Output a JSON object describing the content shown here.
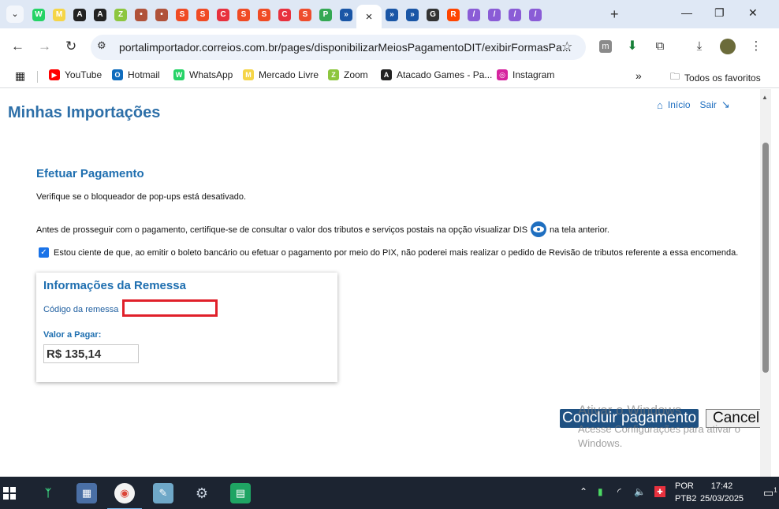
{
  "browser": {
    "tabs": [
      {
        "icon": "whatsapp-icon",
        "color": "#25d366",
        "glyph": "W"
      },
      {
        "icon": "mercadolivre-icon",
        "color": "#f5d547",
        "glyph": "M"
      },
      {
        "icon": "atacado-games-icon",
        "color": "#222222",
        "glyph": "A"
      },
      {
        "icon": "atacado-games-icon",
        "color": "#222222",
        "glyph": "A"
      },
      {
        "icon": "zoom-icon",
        "color": "#8dc63f",
        "glyph": "Z"
      },
      {
        "icon": "avatar-icon",
        "color": "#b0523a",
        "glyph": "•"
      },
      {
        "icon": "avatar-icon",
        "color": "#b0523a",
        "glyph": "•"
      },
      {
        "icon": "shop-icon",
        "color": "#f04b24",
        "glyph": "S"
      },
      {
        "icon": "shop-icon",
        "color": "#f04b24",
        "glyph": "S"
      },
      {
        "icon": "cart-icon",
        "color": "#e8313e",
        "glyph": "C"
      },
      {
        "icon": "shop-icon",
        "color": "#f04b24",
        "glyph": "S"
      },
      {
        "icon": "shop-icon",
        "color": "#f04b24",
        "glyph": "S"
      },
      {
        "icon": "cart-icon",
        "color": "#e8313e",
        "glyph": "C"
      },
      {
        "icon": "shopee-icon",
        "color": "#ee4d2d",
        "glyph": "S"
      },
      {
        "icon": "map-pin-icon",
        "color": "#34a853",
        "glyph": "P"
      },
      {
        "icon": "correios-icon",
        "color": "#1a56a6",
        "glyph": "»"
      },
      {
        "icon": "close-icon",
        "color": "",
        "glyph": "×",
        "active": true
      },
      {
        "icon": "correios-icon",
        "color": "#1a56a6",
        "glyph": "»"
      },
      {
        "icon": "correios-icon",
        "color": "#1a56a6",
        "glyph": "»"
      },
      {
        "icon": "github-icon",
        "color": "#333333",
        "glyph": "G"
      },
      {
        "icon": "reddit-icon",
        "color": "#ff4500",
        "glyph": "R"
      },
      {
        "icon": "feather-icon",
        "color": "#8a5cd6",
        "glyph": "/"
      },
      {
        "icon": "feather-icon",
        "color": "#8a5cd6",
        "glyph": "/"
      },
      {
        "icon": "feather-icon",
        "color": "#8a5cd6",
        "glyph": "/"
      },
      {
        "icon": "feather-icon",
        "color": "#8a5cd6",
        "glyph": "/"
      }
    ],
    "url": "portalimportador.correios.com.br/pages/disponibilizarMeiosPagamentoDIT/exibirFormasPa...",
    "bookmarks": [
      {
        "label": "YouTube",
        "color": "#ff0000",
        "glyph": "▶"
      },
      {
        "label": "Hotmail",
        "color": "#0f6cbd",
        "glyph": "O"
      },
      {
        "label": "WhatsApp",
        "color": "#25d366",
        "glyph": "W"
      },
      {
        "label": "Mercado Livre",
        "color": "#f5d547",
        "glyph": "M"
      },
      {
        "label": "Zoom",
        "color": "#8dc63f",
        "glyph": "Z"
      },
      {
        "label": "Atacado Games - Pa...",
        "color": "#222222",
        "glyph": "A"
      },
      {
        "label": "Instagram",
        "color": "#d6249f",
        "glyph": "◎"
      }
    ],
    "all_bookmarks": "Todos os favoritos"
  },
  "page": {
    "title": "Minhas Importações",
    "home_link": "Início",
    "exit_link": "Sair",
    "section_title": "Efetuar Pagamento",
    "popup_notice": "Verifique se o bloqueador de pop-ups está desativado.",
    "notice_before": "Antes de prosseguir com o pagamento, certifique-se de consultar o valor dos tributos e serviços postais na opção visualizar DIS",
    "notice_after": "na tela anterior.",
    "agreement": "Estou ciente de que, ao emitir o boleto bancário ou efetuar o pagamento por meio do PIX, não poderei mais realizar o pedido de Revisão de tributos referente a essa encomenda.",
    "panel": {
      "title": "Informações da Remessa",
      "code_label": "Código da remessa",
      "value_label": "Valor a Pagar:",
      "value": "R$ 135,14"
    },
    "conclude_button": "Concluir pagamento",
    "cancel_button": "Cancelar",
    "watermark_title": "Ativar o Windows",
    "watermark_text": "Acesse Configurações para ativar o Windows."
  },
  "taskbar": {
    "language": "POR",
    "layout": "PTB2",
    "time": "17:42",
    "date": "25/03/2025",
    "notification_count": "1"
  }
}
